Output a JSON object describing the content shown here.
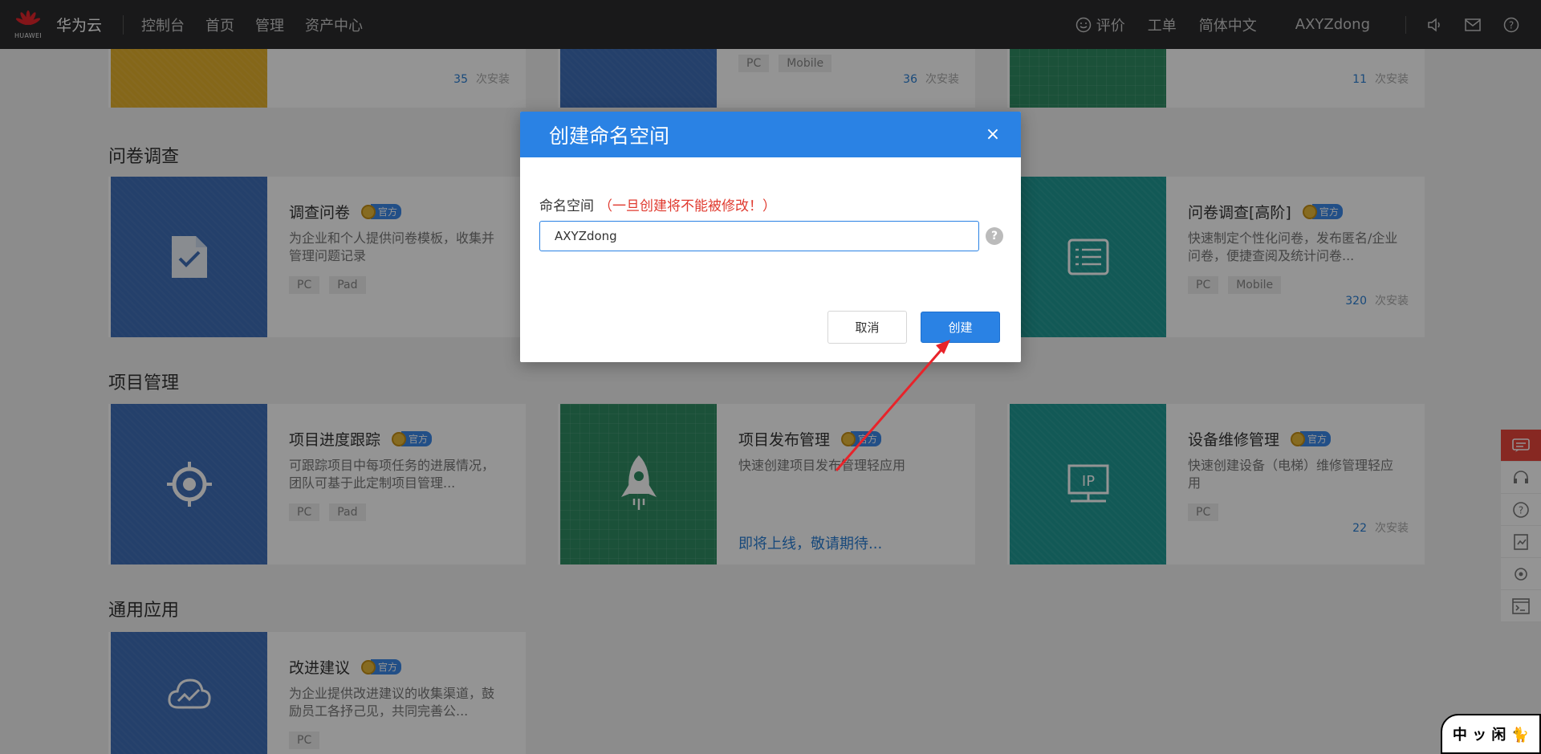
{
  "nav": {
    "logo_word": "HUAWEI",
    "brand": "华为云",
    "items": [
      "控制台",
      "首页",
      "管理",
      "资产中心"
    ],
    "right": {
      "review": "评价",
      "ticket": "工单",
      "lang": "简体中文",
      "user": "AXYZdong"
    }
  },
  "top_row": {
    "cards": [
      {
        "installs": "35",
        "installs_label": "次安装",
        "color": "yellow"
      },
      {
        "installs": "36",
        "installs_label": "次安装",
        "tags": [
          "PC",
          "Mobile"
        ],
        "color": "blue"
      },
      {
        "installs": "11",
        "installs_label": "次安装",
        "color": "green"
      }
    ]
  },
  "sections": {
    "survey": {
      "title": "问卷调查",
      "cards": [
        {
          "title": "调查问卷",
          "official": "官方",
          "desc": "为企业和个人提供问卷模板，收集并管理问题记录",
          "tags": [
            "PC",
            "Pad"
          ]
        },
        {
          "title": "问卷调查[高阶]",
          "official": "官方",
          "desc": "快速制定个性化问卷，发布匿名/企业问卷，便捷查阅及统计问卷...",
          "tags": [
            "PC",
            "Mobile"
          ],
          "installs": "320",
          "installs_label": "次安装"
        }
      ]
    },
    "project": {
      "title": "项目管理",
      "cards": [
        {
          "title": "项目进度跟踪",
          "official": "官方",
          "desc": "可跟踪项目中每项任务的进展情况，团队可基于此定制项目管理...",
          "tags": [
            "PC",
            "Pad"
          ]
        },
        {
          "title": "项目发布管理",
          "official": "官方",
          "desc": "快速创建项目发布管理轻应用",
          "coming_soon": "即将上线，敬请期待..."
        },
        {
          "title": "设备维修管理",
          "official": "官方",
          "desc": "快速创建设备（电梯）维修管理轻应用",
          "tags": [
            "PC"
          ],
          "installs": "22",
          "installs_label": "次安装"
        }
      ]
    },
    "general": {
      "title": "通用应用",
      "cards": [
        {
          "title": "改进建议",
          "official": "官方",
          "desc": "为企业提供改进建议的收集渠道，鼓励员工各抒己见，共同完善公...",
          "tags": [
            "PC"
          ]
        }
      ]
    }
  },
  "dialog": {
    "title": "创建命名空间",
    "close": "×",
    "field_label": "命名空间",
    "field_warning": "（一旦创建将不能被修改！）",
    "field_value": "AXYZdong",
    "help": "?",
    "cancel": "取消",
    "create": "创建"
  },
  "watermark": "中 ッ 闲 🐈",
  "colors": {
    "primary": "#2a82e4",
    "warning": "#e03a2f",
    "annotation_arrow": "#e8232a"
  }
}
